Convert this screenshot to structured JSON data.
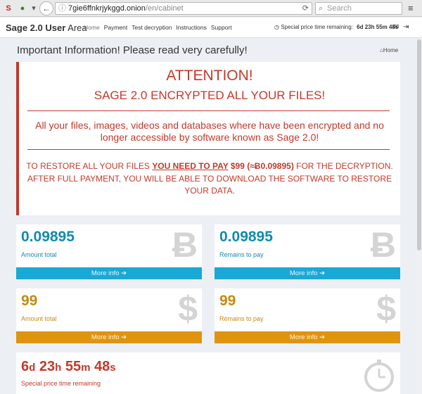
{
  "browser": {
    "url_domain": "7gie6ffnkrjykggd.onion",
    "url_path": "/en/cabinet",
    "search_placeholder": "Search",
    "reload_glyph": "⟳",
    "menu_glyph": "≡",
    "back_glyph": "←",
    "dropdown_glyph": "▾",
    "info_glyph": "ⓘ",
    "search_glyph": "⌕",
    "favicon_text": "S"
  },
  "navbar": {
    "brand_bold": "Sage 2.0 User",
    "brand_rest": " Area",
    "items": [
      "Home",
      "Payment",
      "Test decryption",
      "Instructions",
      "Support"
    ],
    "timer_label": "Special price time remaining:",
    "timer_value": "6d 23h 55m 48s",
    "clock_glyph": "◷",
    "mail_glyph": "✉",
    "logout_glyph": "⇥"
  },
  "page": {
    "title": "Important Information! Please read very carefully!",
    "breadcrumb_icon": "⌂",
    "breadcrumb": "Home"
  },
  "attention": {
    "heading": "ATTENTION!",
    "subheading": "SAGE 2.0 ENCRYPTED ALL YOUR FILES!",
    "description": "All your files, images, videos and databases where have been encrypted and no longer accessible by software known as Sage 2.0!",
    "restore_pre": "TO RESTORE ALL YOUR FILES ",
    "restore_emph": "YOU NEED TO PAY",
    "restore_price": " $99 (≈Ƀ0.09895)",
    "restore_post": " FOR THE DECRYPTION.",
    "restore_line2": "AFTER FULL PAYMENT, YOU WILL BE ABLE TO DOWNLOAD THE SOFTWARE TO RESTORE YOUR DATA."
  },
  "boxes": [
    {
      "value": "0.09895",
      "label": "Amount total",
      "icon": "Ƀ",
      "more": "More info ➔"
    },
    {
      "value": "0.09895",
      "label": "Remains to pay",
      "icon": "Ƀ",
      "more": "More info ➔"
    },
    {
      "value": "99",
      "label": "Amount total",
      "icon": "$",
      "more": "More info ➔"
    },
    {
      "value": "99",
      "label": "Remains to pay",
      "icon": "$",
      "more": "More info ➔"
    }
  ],
  "timer": {
    "d": "6",
    "d_unit": "d",
    "h": "23",
    "h_unit": "h",
    "m": "55",
    "m_unit": "m",
    "s": "48",
    "s_unit": "s",
    "label": "Special price time remaining"
  },
  "colors": {
    "accent_red": "#c43929",
    "blue": "#18a9d6",
    "orange": "#e0940e"
  }
}
